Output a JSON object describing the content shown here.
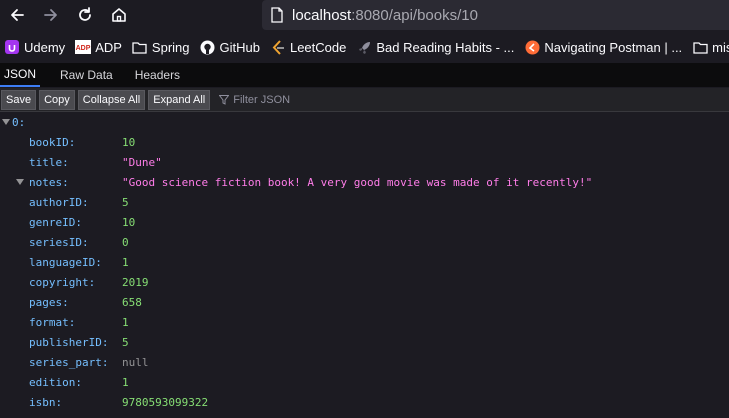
{
  "url": {
    "host": "localhost",
    "path": ":8080/api/books/10"
  },
  "bookmarks": [
    {
      "label": "Udemy",
      "icon": "udemy-icon"
    },
    {
      "label": "ADP",
      "icon": "adp-icon"
    },
    {
      "label": "Spring",
      "icon": "folder-icon"
    },
    {
      "label": "GitHub",
      "icon": "github-icon"
    },
    {
      "label": "LeetCode",
      "icon": "leetcode-icon"
    },
    {
      "label": "Bad Reading Habits - ...",
      "icon": "rocket-icon"
    },
    {
      "label": "Navigating Postman | ...",
      "icon": "postman-icon"
    },
    {
      "label": "misc",
      "icon": "folder-icon"
    }
  ],
  "tabs": [
    "JSON",
    "Raw Data",
    "Headers"
  ],
  "toolbar": {
    "save": "Save",
    "copy": "Copy",
    "collapse_all": "Collapse All",
    "expand_all": "Expand All",
    "filter_placeholder": "Filter JSON"
  },
  "json": {
    "root_key": "0:",
    "rows": [
      {
        "key": "bookID:",
        "value": "10",
        "type": "num"
      },
      {
        "key": "title:",
        "value": "\"Dune\"",
        "type": "str"
      },
      {
        "key": "notes:",
        "value": "\"Good science fiction book! A very good movie was made of it recently!\"",
        "type": "str"
      },
      {
        "key": "authorID:",
        "value": "5",
        "type": "num"
      },
      {
        "key": "genreID:",
        "value": "10",
        "type": "num"
      },
      {
        "key": "seriesID:",
        "value": "0",
        "type": "num"
      },
      {
        "key": "languageID:",
        "value": "1",
        "type": "num"
      },
      {
        "key": "copyright:",
        "value": "2019",
        "type": "num"
      },
      {
        "key": "pages:",
        "value": "658",
        "type": "num"
      },
      {
        "key": "format:",
        "value": "1",
        "type": "num"
      },
      {
        "key": "publisherID:",
        "value": "5",
        "type": "num"
      },
      {
        "key": "series_part:",
        "value": "null",
        "type": "null"
      },
      {
        "key": "edition:",
        "value": "1",
        "type": "num"
      },
      {
        "key": "isbn:",
        "value": "9780593099322",
        "type": "num"
      }
    ]
  },
  "colors": {
    "key": "#75bfff",
    "number": "#86de74",
    "string": "#ff7de9",
    "null": "#939395",
    "accent": "#3d7ef5"
  }
}
